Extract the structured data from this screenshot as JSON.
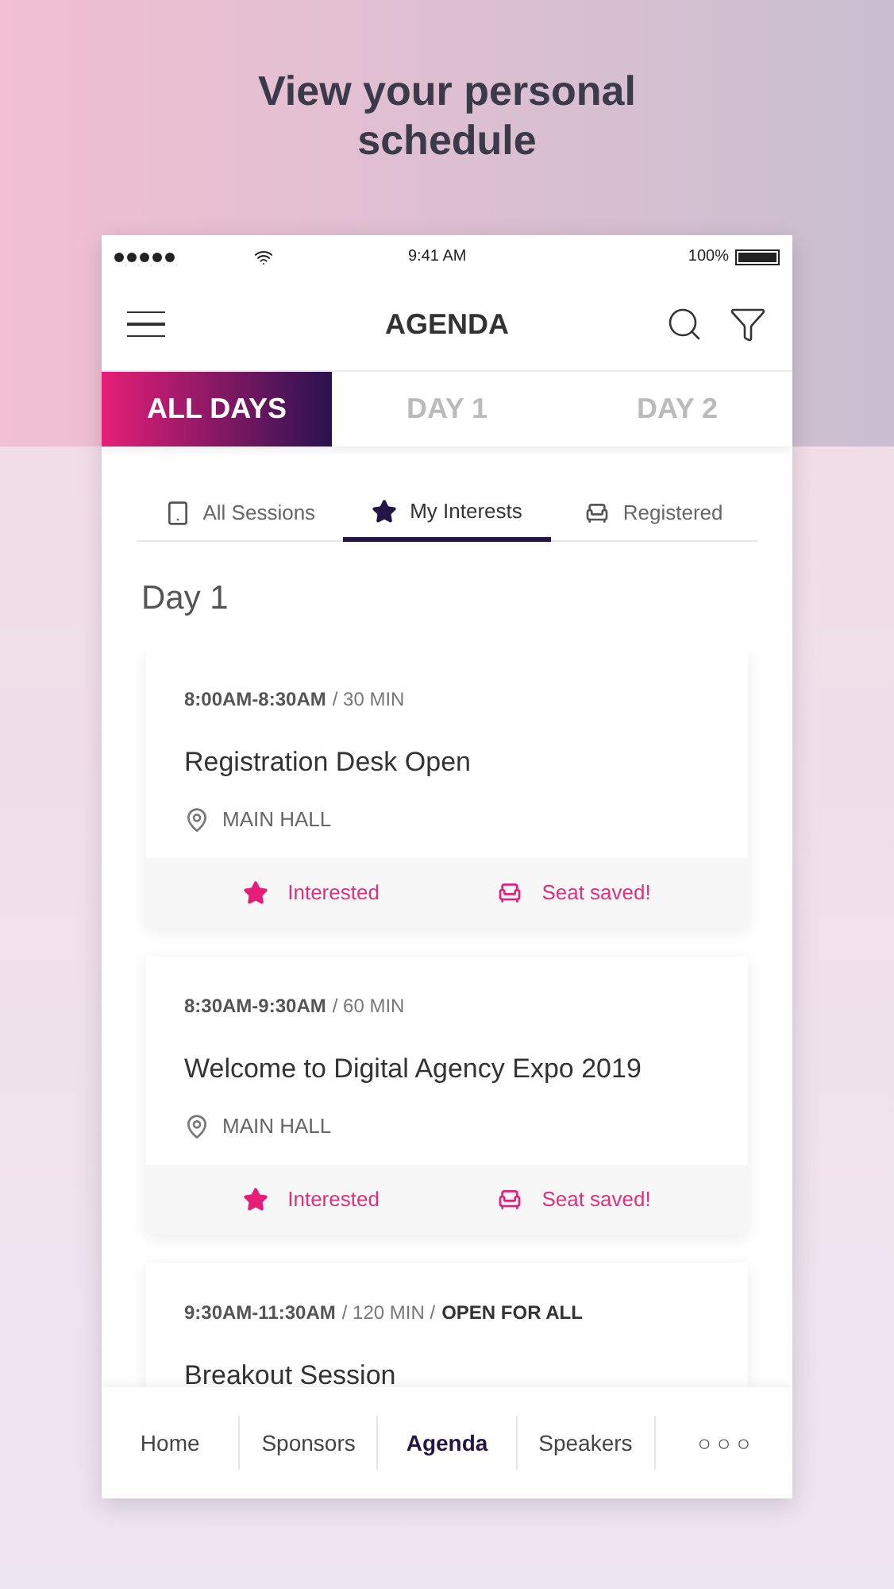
{
  "headline": "View your personal schedule",
  "status_bar": {
    "time": "9:41 AM",
    "battery": "100%"
  },
  "header": {
    "title": "AGENDA"
  },
  "day_tabs": [
    {
      "label": "ALL DAYS",
      "selected": true
    },
    {
      "label": "DAY 1",
      "selected": false
    },
    {
      "label": "DAY 2",
      "selected": false
    }
  ],
  "filter_tabs": [
    {
      "label": "All Sessions",
      "kind": "sessions",
      "selected": false
    },
    {
      "label": "My Interests",
      "kind": "interests",
      "selected": true
    },
    {
      "label": "Registered",
      "kind": "registered",
      "selected": false
    }
  ],
  "section_title": "Day 1",
  "sessions": [
    {
      "time": "8:00AM-8:30AM",
      "duration": "/ 30 MIN",
      "title": "Registration Desk Open",
      "location": "MAIN HALL",
      "interested": "Interested",
      "seat": "Seat saved!"
    },
    {
      "time": "8:30AM-9:30AM",
      "duration": "/ 60 MIN",
      "title": "Welcome to Digital Agency Expo 2019",
      "location": "MAIN HALL",
      "interested": "Interested",
      "seat": "Seat saved!"
    },
    {
      "time": "9:30AM-11:30AM",
      "duration": "/ 120 MIN /",
      "access": "OPEN FOR ALL",
      "title": "Breakout Session"
    }
  ],
  "bottom_nav": [
    {
      "label": "Home",
      "selected": false
    },
    {
      "label": "Sponsors",
      "selected": false
    },
    {
      "label": "Agenda",
      "selected": true
    },
    {
      "label": "Speakers",
      "selected": false
    },
    {
      "label": "○ ○ ○",
      "selected": false
    }
  ]
}
